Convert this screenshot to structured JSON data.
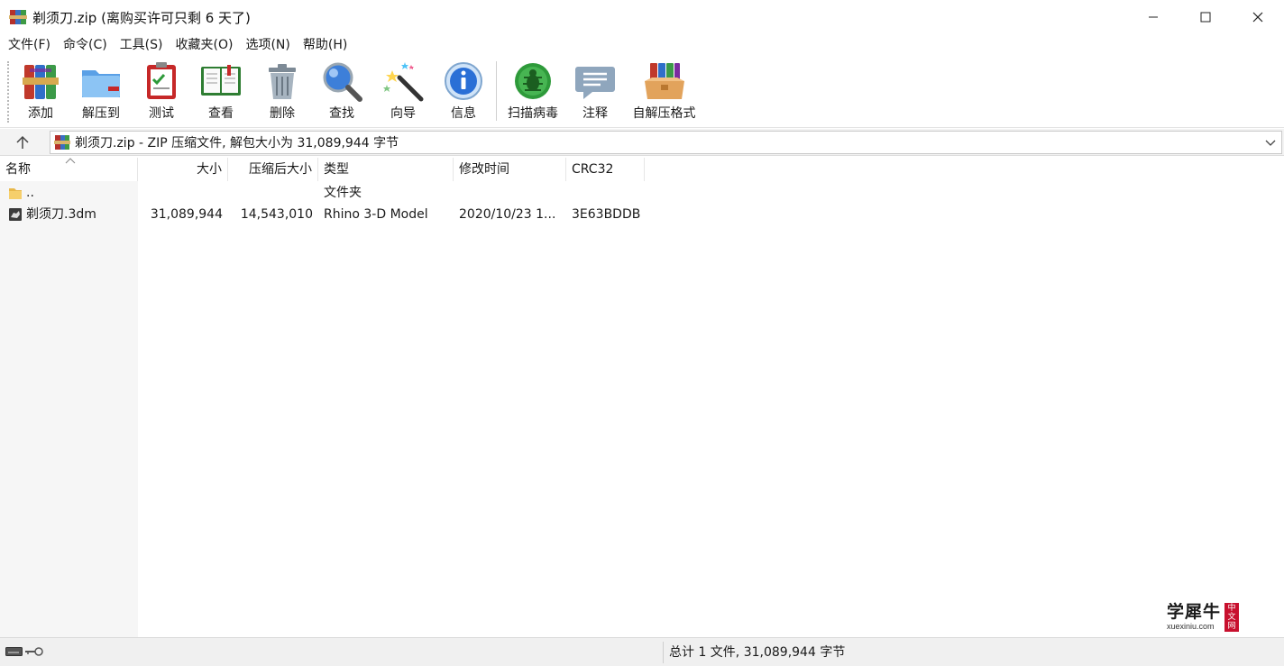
{
  "window": {
    "title": "剃须刀.zip (离购买许可只剩 6 天了)"
  },
  "menu": [
    "文件(F)",
    "命令(C)",
    "工具(S)",
    "收藏夹(O)",
    "选项(N)",
    "帮助(H)"
  ],
  "toolbar": [
    {
      "label": "添加",
      "icon": "add-archive-icon"
    },
    {
      "label": "解压到",
      "icon": "extract-folder-icon"
    },
    {
      "label": "测试",
      "icon": "test-clipboard-icon"
    },
    {
      "label": "查看",
      "icon": "view-book-icon"
    },
    {
      "label": "删除",
      "icon": "trash-icon"
    },
    {
      "label": "查找",
      "icon": "magnifier-icon"
    },
    {
      "label": "向导",
      "icon": "wizard-wand-icon"
    },
    {
      "label": "信息",
      "icon": "info-icon"
    },
    {
      "label": "扫描病毒",
      "icon": "virus-scan-icon"
    },
    {
      "label": "注释",
      "icon": "comment-icon"
    },
    {
      "label": "自解压格式",
      "icon": "sfx-box-icon"
    }
  ],
  "address": {
    "path": "剃须刀.zip - ZIP 压缩文件, 解包大小为 31,089,944 字节"
  },
  "columns": {
    "name": "名称",
    "size": "大小",
    "packed": "压缩后大小",
    "type": "类型",
    "modified": "修改时间",
    "crc": "CRC32"
  },
  "rows": [
    {
      "name": "..",
      "size": "",
      "packed": "",
      "type": "文件夹",
      "modified": "",
      "crc": "",
      "icon": "folder-icon"
    },
    {
      "name": "剃须刀.3dm",
      "size": "31,089,944",
      "packed": "14,543,010",
      "type": "Rhino 3-D Model",
      "modified": "2020/10/23 1...",
      "crc": "3E63BDDB",
      "icon": "rhino-file-icon"
    }
  ],
  "watermark": {
    "cn": "学犀牛",
    "en": "xuexiniu.com",
    "tag": [
      "中",
      "文",
      "网"
    ]
  },
  "status": {
    "summary": "总计 1 文件, 31,089,944 字节"
  },
  "colors": {
    "accent_blue": "#2a6fd6",
    "winrar_red": "#c62828",
    "status_bg": "#f0f0f0"
  }
}
